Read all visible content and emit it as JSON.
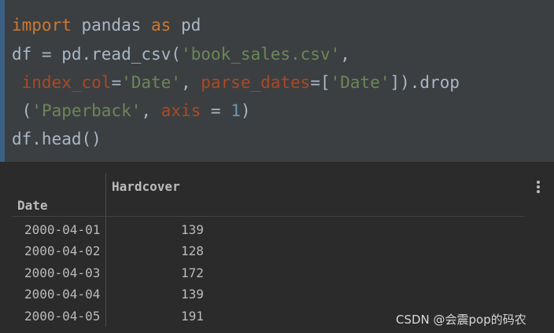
{
  "code": {
    "line1": {
      "t1": "import",
      "t2": " pandas ",
      "t3": "as",
      "t4": " pd"
    },
    "line2": {
      "t1": "df = pd.read_csv(",
      "t2": "'book_sales.csv'",
      "t3": ","
    },
    "line3": {
      "t1": " index_col",
      "t2": "=",
      "t3": "'Date'",
      "t4": ", ",
      "t5": "parse_dates",
      "t6": "=[",
      "t7": "'Date'",
      "t8": "]).drop"
    },
    "line4": {
      "t1": " (",
      "t2": "'Paperback'",
      "t3": ", ",
      "t4": "axis",
      "t5": " = ",
      "t6": "1",
      "t7": ")"
    },
    "line5": {
      "t1": "df.head()"
    }
  },
  "table": {
    "column_header": "Hardcover",
    "index_header": "Date",
    "rows": [
      {
        "date": "2000-04-01",
        "value": "139"
      },
      {
        "date": "2000-04-02",
        "value": "128"
      },
      {
        "date": "2000-04-03",
        "value": "172"
      },
      {
        "date": "2000-04-04",
        "value": "139"
      },
      {
        "date": "2000-04-05",
        "value": "191"
      }
    ]
  },
  "icons": {
    "menu": "kebab-menu-icon"
  },
  "watermark": "CSDN @会震pop的码农",
  "colors": {
    "keyword": "#cc7832",
    "string": "#6a8759",
    "number": "#6897bb",
    "parameter": "#aa4926",
    "text": "#a9b7c6"
  }
}
